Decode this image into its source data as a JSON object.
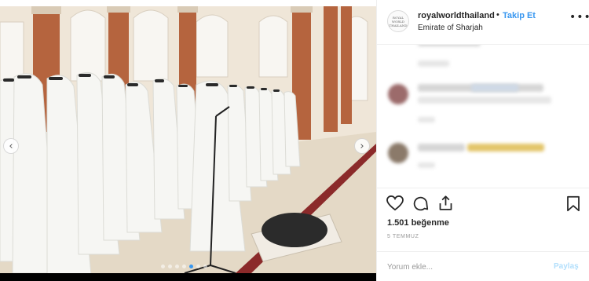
{
  "post": {
    "photo_alt": "Funeral prayer inside a mosque",
    "carousel": {
      "total": 7,
      "active": 4
    },
    "nav": {
      "prev_icon": "chevron-left-icon",
      "next_icon": "chevron-right-icon",
      "prev_glyph": "‹",
      "next_glyph": "›"
    }
  },
  "header": {
    "username": "royalworldthailand",
    "separator": "•",
    "follow_label": "Takip Et",
    "location": "Emirate of Sharjah",
    "avatar_text": "ROYAL WORLD THAILAND",
    "more_glyph": "•••"
  },
  "actions": {
    "like_icon": "heart-icon",
    "comment_icon": "comment-icon",
    "share_icon": "share-icon",
    "save_icon": "bookmark-icon",
    "likes_text": "1.501 beğenme",
    "date_text": "5 TEMMUZ"
  },
  "comment_box": {
    "placeholder": "Yorum ekle...",
    "post_label": "Paylaş"
  },
  "colors": {
    "link_blue": "#3897f0",
    "disabled_blue": "#b2dffc",
    "text": "#262626",
    "muted": "#999999"
  }
}
